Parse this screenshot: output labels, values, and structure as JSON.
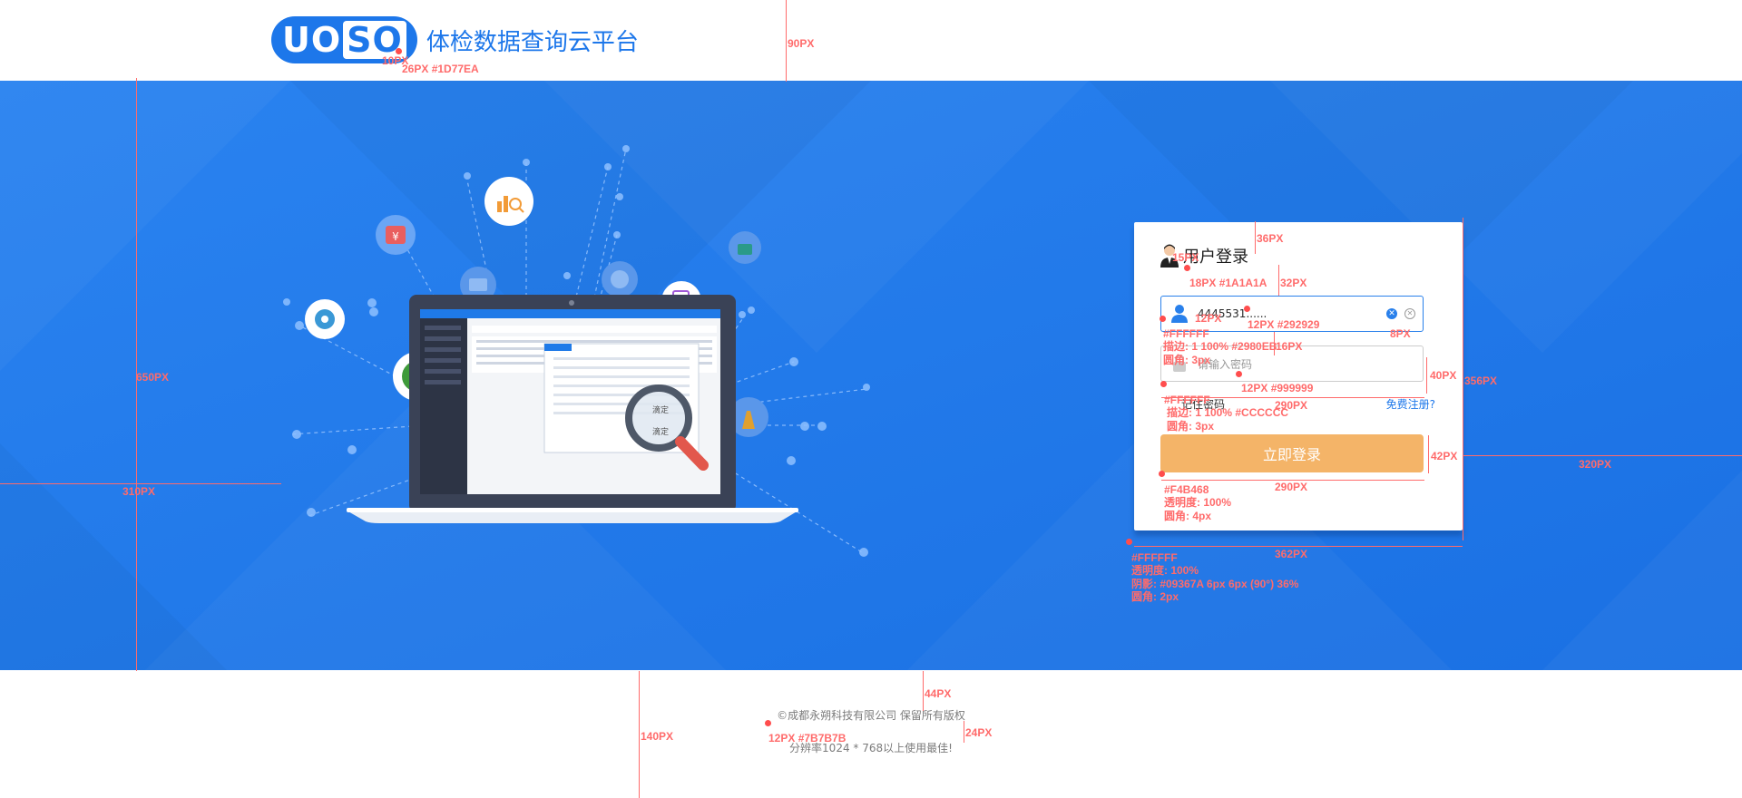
{
  "header": {
    "logo_letters_a": "UO",
    "logo_letters_b": "SO",
    "site_title": "体检数据查询云平台"
  },
  "login": {
    "title": "用户登录",
    "username_value": "4445531......",
    "password_placeholder": "请输入密码",
    "remember_label": "记住密码",
    "register_link": "免费注册?",
    "submit_label": "立即登录"
  },
  "footer": {
    "copyright": "©成都永朔科技有限公司    保留所有版权",
    "resolution_note": "分辨率1024 * 768以上使用最佳!"
  },
  "annotations": {
    "header_height": "90PX",
    "logo_gap": "10PX",
    "logo_font": "26PX #1D77EA",
    "banner_height": "650PX",
    "illus_offset": "310PX",
    "card_offset_right": "320PX",
    "title_gap": "36PX",
    "title_icon_gap": "15PX",
    "title_font": "18PX #1A1A1A",
    "title_field_gap": "32PX",
    "user_field_fill": "#FFFFFF",
    "user_field_border": "描边: 1 100% #2980EB",
    "user_field_radius": "圆角: 3px",
    "user_icon_gap": "12PX",
    "input_font": "12PX #292929",
    "clear_gap": "8PX",
    "field_gap": "16PX",
    "field_height": "40PX",
    "placeholder_font": "12PX #999999",
    "field_width": "290PX",
    "pass_field_fill": "#FFFFFF",
    "pass_field_border": "描边: 1 100% #CCCCCC",
    "pass_field_radius": "圆角: 3px",
    "card_height": "356PX",
    "btn_height": "42PX",
    "btn_color": "#F4B468",
    "btn_opacity": "透明度: 100%",
    "btn_radius": "圆角: 4px",
    "btn_width": "290PX",
    "card_width": "362PX",
    "card_fill": "#FFFFFF",
    "card_opacity": "透明度: 100%",
    "card_shadow": "阴影: #09367A 6px 6px (90°) 36%",
    "card_radius": "圆角: 2px",
    "footer_height": "140PX",
    "footer_gap": "44PX",
    "footer_font": "12PX #7B7B7B",
    "footer_line_gap": "24PX"
  },
  "colors": {
    "brand": "#1D77EA",
    "banner_bg": "#2079ec",
    "button": "#F4B468"
  }
}
